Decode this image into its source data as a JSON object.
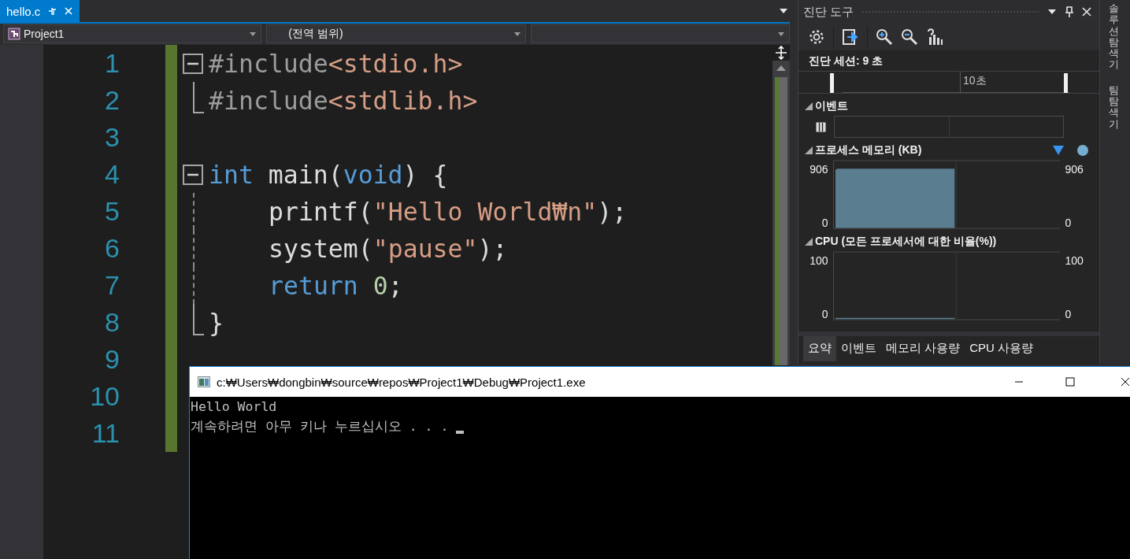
{
  "editor_tabs": [
    {
      "label": "hello.c",
      "selected": true
    }
  ],
  "navigation": {
    "project": "Project1",
    "scope": "(전역 범위)"
  },
  "code_lines": [
    {
      "number": "1",
      "kind": "block-start",
      "indented": false,
      "tokens": [
        {
          "kind": "preprocessor",
          "text": "#include"
        },
        {
          "kind": "path",
          "text": "<stdio.h>"
        }
      ]
    },
    {
      "number": "2",
      "kind": "block-end",
      "indented": false,
      "tokens": [
        {
          "kind": "preprocessor",
          "text": "#include"
        },
        {
          "kind": "path",
          "text": "<stdlib.h>"
        }
      ]
    },
    {
      "number": "3",
      "kind": "plain"
    },
    {
      "number": "4",
      "kind": "block-start",
      "indented": false,
      "tokens": [
        {
          "kind": "keyword",
          "text": "int"
        },
        {
          "kind": "plain",
          "text": " main("
        },
        {
          "kind": "keyword",
          "text": "void"
        },
        {
          "kind": "plain",
          "text": ") {"
        }
      ]
    },
    {
      "number": "5",
      "kind": "block-body",
      "indented": true,
      "tokens": [
        {
          "kind": "plain",
          "text": "printf("
        },
        {
          "kind": "string",
          "text": "\"Hello World₩n\""
        },
        {
          "kind": "plain",
          "text": ");"
        }
      ]
    },
    {
      "number": "6",
      "kind": "block-body",
      "indented": true,
      "tokens": [
        {
          "kind": "plain",
          "text": "system("
        },
        {
          "kind": "string",
          "text": "\"pause\""
        },
        {
          "kind": "plain",
          "text": ");"
        }
      ]
    },
    {
      "number": "7",
      "kind": "block-body",
      "indented": true,
      "tokens": [
        {
          "kind": "keyword",
          "text": "return "
        },
        {
          "kind": "number",
          "text": "0"
        },
        {
          "kind": "plain",
          "text": ";"
        }
      ]
    },
    {
      "number": "8",
      "kind": "block-end",
      "indented": false,
      "tokens": [
        {
          "kind": "plain",
          "text": "}"
        }
      ]
    },
    {
      "number": "9",
      "kind": "plain"
    },
    {
      "number": "10",
      "kind": "plain"
    },
    {
      "number": "11",
      "kind": "plain"
    }
  ],
  "diagnostics": {
    "title": "진단 도구",
    "session": "진단 세션: 9 초",
    "ruler_label": "10초",
    "sections": [
      {
        "kind": "events",
        "title": "이벤트",
        "expanded": true
      },
      {
        "kind": "area-graph",
        "title": "프로세스 메모리 (KB)",
        "expanded": true,
        "legend": true,
        "left_max": "906",
        "left_min": "0",
        "right_max": "906",
        "right_min": "0"
      },
      {
        "kind": "line-graph",
        "title": "CPU (모든 프로세서에 대한 비율(%))",
        "expanded": true,
        "legend": false,
        "left_max": "100",
        "left_min": "0",
        "right_max": "100",
        "right_min": "0"
      }
    ],
    "tabs": [
      {
        "label": "요약",
        "selected": true
      },
      {
        "label": "이벤트",
        "selected": false
      },
      {
        "label": "메모리 사용량",
        "selected": false
      },
      {
        "label": "CPU 사용량",
        "selected": false
      }
    ]
  },
  "side_tabs": [
    {
      "label": "솔루션 탐색기"
    },
    {
      "label": "팀 탐색기"
    }
  ],
  "console": {
    "title": "c:₩Users₩dongbin₩source₩repos₩Project1₩Debug₩Project1.exe",
    "lines": [
      "Hello World",
      "계속하려면 아무 키나 누르십시오 . . . "
    ],
    "cursor": true
  }
}
